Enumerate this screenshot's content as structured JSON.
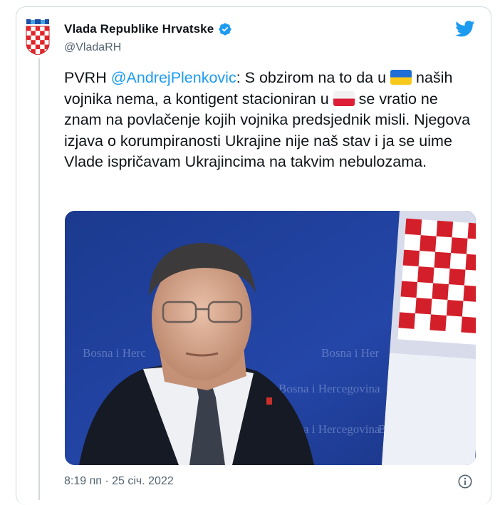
{
  "account": {
    "display_name": "Vlada Republike Hrvatske",
    "handle": "@VladaRH",
    "verified": true
  },
  "tweet": {
    "prefix": "PVRH ",
    "mention": "@AndrejPlenkovic",
    "text_1": ": S obzirom na to da u ",
    "flag_1": "ukraine-flag",
    "text_2": " naših vojnika nema, a kontigent stacioniran u ",
    "flag_2": "poland-flag",
    "text_3": " se vratio ne znam na povlačenje kojih vojnika predsjednik misli. Njegova izjava o korumpiranosti Ukrajine nije naš stav i ja se uime Vlade ispričavam Ukrajincima na takvim nebulozama.",
    "timestamp": "8:19 пп · 25 січ. 2022"
  },
  "icons": {
    "brand": "twitter-bird-icon",
    "verified": "verified-badge-icon",
    "info": "info-icon",
    "avatar": "croatian-coat-of-arms"
  },
  "colors": {
    "accent": "#1d9bf0",
    "text": "#0f1419",
    "muted": "#536471",
    "border": "#cfd9de"
  }
}
